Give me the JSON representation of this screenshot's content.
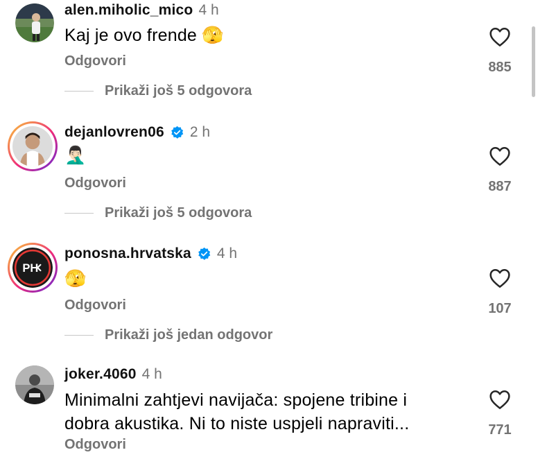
{
  "comments": [
    {
      "username": "alen.miholic_mico",
      "time": "4 h",
      "verified": false,
      "text": "Kaj je ovo frende 🫣",
      "reply_label": "Odgovori",
      "likes": "885",
      "more_replies": "Prikaži još 5 odgovora"
    },
    {
      "username": "dejanlovren06",
      "time": "2 h",
      "verified": true,
      "text": "🤦🏻‍♂️",
      "reply_label": "Odgovori",
      "likes": "887",
      "more_replies": "Prikaži još 5 odgovora"
    },
    {
      "username": "ponosna.hrvatska",
      "time": "4 h",
      "verified": true,
      "text": "🫣",
      "reply_label": "Odgovori",
      "likes": "107",
      "more_replies": "Prikaži još jedan odgovor",
      "avatar_label": "PH"
    },
    {
      "username": "joker.4060",
      "time": "4 h",
      "verified": false,
      "text_line1": "Minimalni zahtjevi navijača: spojene tribine i",
      "text_line2": "dobra akustika. Ni to niste uspjeli napraviti...",
      "reply_label": "Odgovori",
      "likes": "771"
    }
  ],
  "icons": {
    "like": "heart-outline-icon",
    "verified": "verified-badge-icon"
  },
  "colors": {
    "secondary_text": "#737373",
    "verified_blue": "#0095f6",
    "story_ring_start": "#f9ce34",
    "story_ring_mid": "#ee2a7b",
    "story_ring_end": "#6228d7"
  }
}
